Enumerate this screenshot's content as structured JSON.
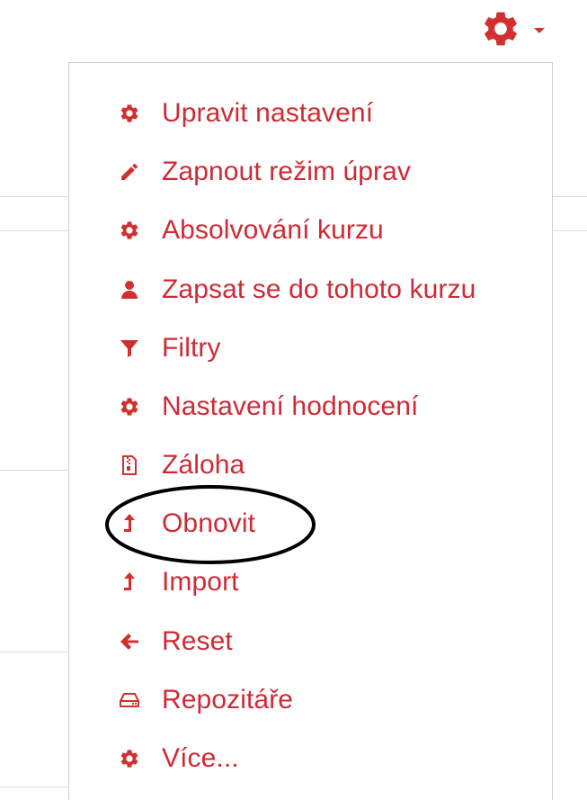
{
  "colors": {
    "accent": "#cf2a35",
    "icon": "#d32f2f",
    "divider": "#dcdcdc",
    "menu_border": "#d0d0d0",
    "annotation": "#000000"
  },
  "toggle": {
    "icon": "gear-icon",
    "caret": "caret-down-icon"
  },
  "menu": {
    "items": [
      {
        "label": "Upravit nastavení",
        "icon": "gear-icon"
      },
      {
        "label": "Zapnout režim úprav",
        "icon": "pencil-icon"
      },
      {
        "label": "Absolvování kurzu",
        "icon": "gear-icon"
      },
      {
        "label": "Zapsat se do tohoto kurzu",
        "icon": "user-icon"
      },
      {
        "label": "Filtry",
        "icon": "filter-icon"
      },
      {
        "label": "Nastavení hodnocení",
        "icon": "gear-icon"
      },
      {
        "label": "Záloha",
        "icon": "file-archive-icon"
      },
      {
        "label": "Obnovit",
        "icon": "level-up-icon",
        "highlighted": true
      },
      {
        "label": "Import",
        "icon": "level-up-icon"
      },
      {
        "label": "Reset",
        "icon": "arrow-left-icon"
      },
      {
        "label": "Repozitáře",
        "icon": "hdd-icon"
      },
      {
        "label": "Více...",
        "icon": "gear-icon"
      }
    ]
  }
}
